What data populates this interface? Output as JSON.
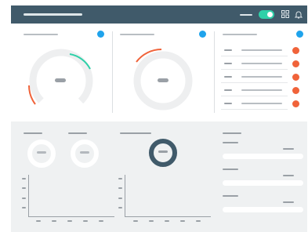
{
  "header": {
    "toggle_state": "on",
    "grid_icon": "grid-icon",
    "bell_icon": "bell-icon"
  },
  "colors": {
    "header_bg": "#405a6a",
    "accent_teal": "#2fd0a8",
    "accent_blue": "#1fa3ec",
    "accent_orange": "#f0633a",
    "panel_bg": "#eff1f2"
  },
  "widgets": {
    "gauge_1": {
      "arc_colors": [
        "#2fd0a8",
        "#f0633a"
      ]
    },
    "gauge_2": {
      "arc_colors": [
        "#f0633a"
      ]
    },
    "list": {
      "row_count": 6,
      "status_color": "#f0633a"
    }
  },
  "bottom": {
    "chart_left": {
      "y_ticks": 4,
      "x_ticks": 5
    },
    "chart_right": {
      "y_ticks": 4,
      "x_ticks": 5
    },
    "settings_rows": 3
  }
}
